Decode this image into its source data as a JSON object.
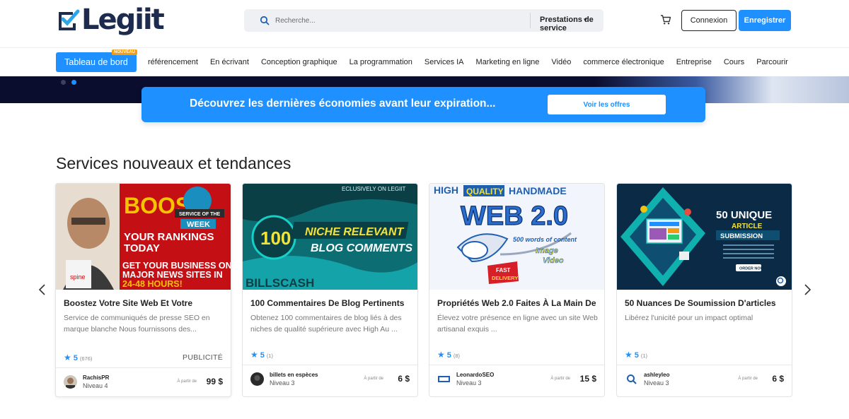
{
  "header": {
    "logo_text": "Legiit",
    "search_placeholder": "Recherche...",
    "search_category": "Prestations de service",
    "login_label": "Connexion",
    "register_label": "Enregistrer"
  },
  "nav": {
    "dashboard_label": "Tableau de bord",
    "new_badge": "NOUVEAU",
    "items": [
      "référencement",
      "En écrivant",
      "Conception graphique",
      "La programmation",
      "Services IA",
      "Marketing en ligne",
      "Vidéo",
      "commerce électronique",
      "Entreprise",
      "Cours",
      "Parcourir"
    ]
  },
  "promo": {
    "text": "Découvrez les dernières économies avant leur expiration...",
    "button": "Voir les offres"
  },
  "section_title": "Services nouveaux et tendances",
  "cards": [
    {
      "title": "Boostez Votre Site Web Et Votre",
      "description": "Service de communiqués de presse SEO en marque blanche Nous fournissons des...",
      "rating": "5",
      "count": "(676)",
      "ad_label": "PUBLICITÉ",
      "seller": "RachisPR",
      "level": "Niveau 4",
      "from": "À partir de",
      "price": "99 $",
      "image_text": {
        "a": "BOOS",
        "b": "YOUR RANKINGS",
        "c": "TODAY",
        "d": "GET YOUR BUSINESS ON",
        "e": "MAJOR NEWS SITES IN",
        "f": "24-48 HOURS!",
        "g": "SERVICE OF THE",
        "h": "WEEK",
        "i": "spine"
      }
    },
    {
      "title": "100 Commentaires De Blog Pertinents",
      "description": "Obtenez 100 commentaires de blog liés à des niches de qualité supérieure avec High Au ...",
      "rating": "5",
      "count": "(1)",
      "seller": "billets en espèces",
      "level": "Niveau 3",
      "from": "À partir de",
      "price": "6 $",
      "image_text": {
        "a": "ECLUSIVELY ON LEGIIT",
        "b": "100",
        "c": "NICHE RELEVANT",
        "d": "BLOG COMMENTS",
        "e": "BILLSCASH"
      }
    },
    {
      "title": "Propriétés Web 2.0 Faites À La Main De",
      "description": "Élevez votre présence en ligne avec un site Web artisanal exquis ...",
      "rating": "5",
      "count": "(8)",
      "seller": "LeonardoSEO",
      "level": "Niveau 3",
      "from": "À partir de",
      "price": "15 $",
      "image_text": {
        "a": "HIGH",
        "b": "QUALITY",
        "c": "HANDMADE",
        "d": "WEB 2.0",
        "e": "500 words of content",
        "f": "Image",
        "g": "Video",
        "h": "FAST",
        "i": "DELIVERY"
      }
    },
    {
      "title": "50 Nuances De Soumission D'articles",
      "description": "Libérez l'unicité pour un impact optimal",
      "rating": "5",
      "count": "(1)",
      "seller": "ashleyleo",
      "level": "Niveau 3",
      "from": "À partir de",
      "price": "6 $",
      "image_text": {
        "a": "50 UNIQUE",
        "b": "ARTICLE",
        "c": "SUBMISSION",
        "d": "ORDER NOW"
      }
    }
  ],
  "colors": {
    "accent": "#1e90ff",
    "dark": "#0b0d2e",
    "star": "#1e90ff"
  }
}
